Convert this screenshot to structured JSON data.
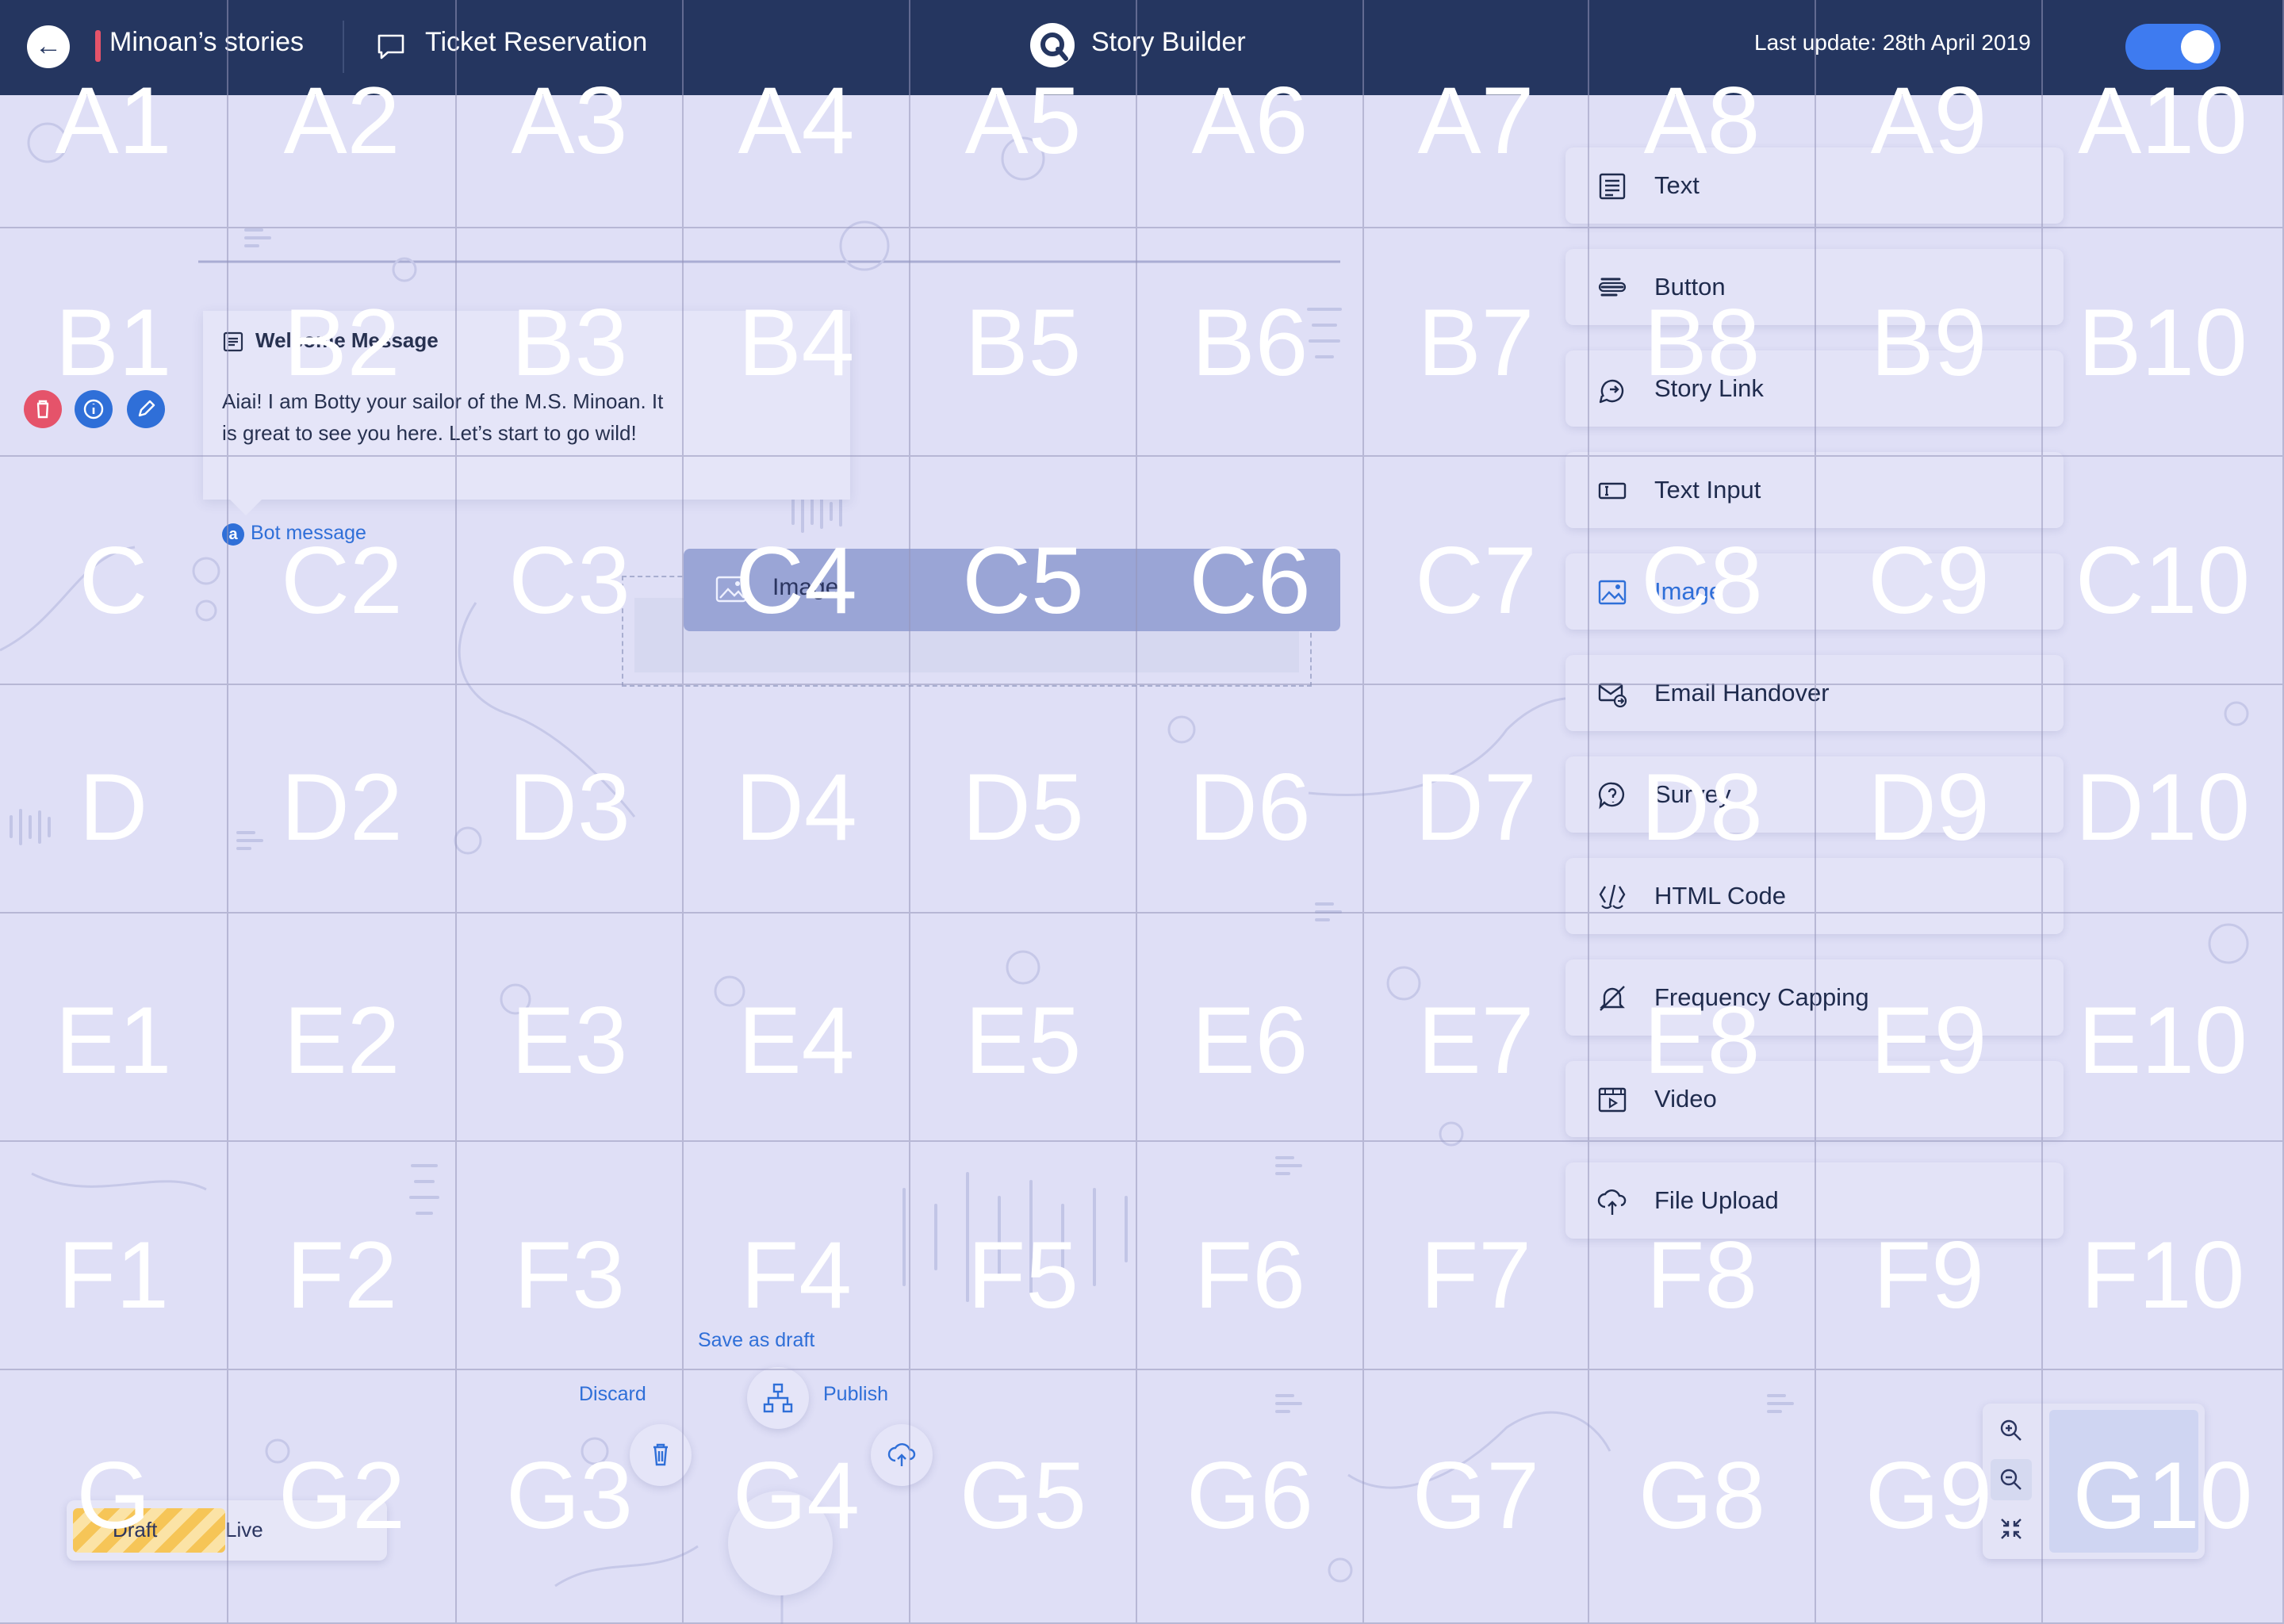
{
  "header": {
    "back_icon": "arrow-left-icon",
    "story_title": "Minoan’s stories",
    "story_name": "Ticket Reservation",
    "app_name": "Story Builder",
    "last_update": "Last update: 28th April 2019",
    "toggle_on": true
  },
  "welcome_card": {
    "title": "Welcome Message",
    "body": "Aiai! I am Botty your sailor of the M.S. Minoan. It is great to see you here. Let’s start to go wild!",
    "label": "Bot message",
    "actions": [
      "delete-icon",
      "info-icon",
      "edit-icon"
    ]
  },
  "drop_zone": {
    "label": "Image"
  },
  "palette": [
    {
      "label": "Text",
      "icon": "text-icon",
      "active": false
    },
    {
      "label": "Button",
      "icon": "button-icon",
      "active": false
    },
    {
      "label": "Story Link",
      "icon": "story-link-icon",
      "active": false
    },
    {
      "label": "Text Input",
      "icon": "text-input-icon",
      "active": false
    },
    {
      "label": "Image",
      "icon": "image-icon",
      "active": true
    },
    {
      "label": "Email Handover",
      "icon": "email-handover-icon",
      "active": false
    },
    {
      "label": "Survey",
      "icon": "survey-icon",
      "active": false
    },
    {
      "label": "HTML Code",
      "icon": "html-code-icon",
      "active": false
    },
    {
      "label": "Frequency Capping",
      "icon": "frequency-capping-icon",
      "active": false
    },
    {
      "label": "Video",
      "icon": "video-icon",
      "active": false
    },
    {
      "label": "File Upload",
      "icon": "file-upload-icon",
      "active": false
    }
  ],
  "actions": {
    "save_as_draft": "Save as draft",
    "discard": "Discard",
    "publish": "Publish"
  },
  "mode_toggle": {
    "draft": "Draft",
    "live": "Live"
  },
  "zoom": [
    "zoom-in-icon",
    "zoom-out-icon",
    "fit-screen-icon"
  ],
  "grid": {
    "columns": [
      "1",
      "2",
      "3",
      "4",
      "5",
      "6",
      "7",
      "8",
      "9",
      "10"
    ],
    "rows": [
      {
        "row": "A",
        "labels": [
          "A1",
          "A2",
          "A3",
          "A4",
          "A5",
          "A6",
          "A7",
          "A8",
          "A9",
          "A10"
        ]
      },
      {
        "row": "B",
        "labels": [
          "B1",
          "B2",
          "B3",
          "B4",
          "B5",
          "B6",
          "B7",
          "B8",
          "B9",
          "B10"
        ]
      },
      {
        "row": "C",
        "labels": [
          "C",
          "C2",
          "C3",
          "C4",
          "C5",
          "C6",
          "C7",
          "C8",
          "C9",
          "C10"
        ]
      },
      {
        "row": "D",
        "labels": [
          "D",
          "D2",
          "D3",
          "D4",
          "D5",
          "D6",
          "D7",
          "D8",
          "D9",
          "D10"
        ]
      },
      {
        "row": "E",
        "labels": [
          "E1",
          "E2",
          "E3",
          "E4",
          "E5",
          "E6",
          "E7",
          "E8",
          "E9",
          "E10"
        ]
      },
      {
        "row": "F",
        "labels": [
          "F1",
          "F2",
          "F3",
          "F4",
          "F5",
          "F6",
          "F7",
          "F8",
          "F9",
          "F10"
        ]
      },
      {
        "row": "G",
        "labels": [
          "G",
          "G2",
          "G3",
          "G4",
          "G5",
          "G6",
          "G7",
          "G8",
          "G9",
          "G10"
        ]
      }
    ]
  },
  "colors": {
    "header_bg": "#253660",
    "canvas_bg": "#dfdff6",
    "accent_blue": "#2f6fd8",
    "toggle_blue": "#3e7bf0",
    "danger_red": "#e5536a",
    "drag_block": "#9aa5d6"
  }
}
